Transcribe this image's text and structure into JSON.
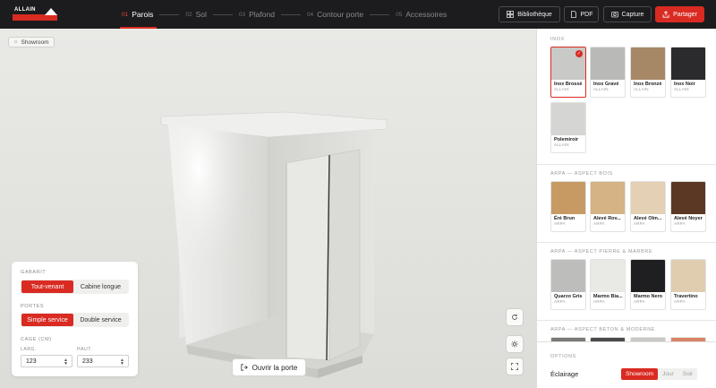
{
  "brand": {
    "name": "ALLAIN"
  },
  "steps": [
    {
      "num": "01",
      "label": "Parois",
      "active": true
    },
    {
      "num": "02",
      "label": "Sol"
    },
    {
      "num": "03",
      "label": "Plafond"
    },
    {
      "num": "04",
      "label": "Contour porte"
    },
    {
      "num": "05",
      "label": "Accessoires"
    }
  ],
  "toolbar": {
    "library": "Bibliothèque",
    "pdf": "PDF",
    "capture": "Capture",
    "share": "Partager"
  },
  "viewport": {
    "showroom_chip": "Showroom",
    "open_door": "Ouvrir la porte"
  },
  "config": {
    "gabarit_label": "GABARIT",
    "gabarit_options": [
      "Tout-venant",
      "Cabine longue"
    ],
    "portes_label": "PORTES",
    "portes_options": [
      "Simple service",
      "Double service"
    ],
    "cage_label": "CAGE (CM)",
    "larg_label": "LARG.",
    "haut_label": "HAUT.",
    "larg_value": "123",
    "haut_value": "233"
  },
  "materials": {
    "inox_title": "INOX",
    "inox": [
      {
        "name": "Inox Brossé",
        "brand": "ALLAIN",
        "color": "#c9c9c7",
        "selected": true
      },
      {
        "name": "Inox Gravé",
        "brand": "ALLAIN",
        "color": "#b9b9b7"
      },
      {
        "name": "Inox Bronzé",
        "brand": "ALLAIN",
        "color": "#a68866"
      },
      {
        "name": "Inox Noir",
        "brand": "ALLAIN",
        "color": "#2b2b2d"
      },
      {
        "name": "Polemiroir",
        "brand": "ALLAIN",
        "color": "#d5d5d3"
      }
    ],
    "bois_title": "ARPA — ASPECT BOIS",
    "bois": [
      {
        "name": "Éré Brun",
        "brand": "ARPA",
        "color": "#c89a63"
      },
      {
        "name": "Alevé Rov...",
        "brand": "ARPA",
        "color": "#d5b384"
      },
      {
        "name": "Alevé Olm...",
        "brand": "ARPA",
        "color": "#e3d0b5"
      },
      {
        "name": "Alevé Noyer",
        "brand": "ARPA",
        "color": "#5a3823"
      }
    ],
    "pierre_title": "ARPA — ASPECT PIERRE & MARBRE",
    "pierre": [
      {
        "name": "Quarzo Gris",
        "brand": "ARPA",
        "color": "#bdbdbb"
      },
      {
        "name": "Marmo Bia...",
        "brand": "ARPA",
        "color": "#e9e9e6"
      },
      {
        "name": "Marmo Nero",
        "brand": "ARPA",
        "color": "#1f1f21"
      },
      {
        "name": "Travertino",
        "brand": "ARPA",
        "color": "#e0cdb0"
      }
    ],
    "beton_title": "ARPA — ASPECT BÉTON & MODERNE",
    "beton_colors": [
      "#7a7a78",
      "#4a4a4a",
      "#c8c8c6",
      "#d98465"
    ]
  },
  "options": {
    "title": "OPTIONS",
    "lighting_label": "Éclairage",
    "lighting_options": [
      "Showroom",
      "Jour",
      "Soir"
    ]
  },
  "colors": {
    "accent": "#d92b22",
    "topbar": "#1c1c1e"
  }
}
